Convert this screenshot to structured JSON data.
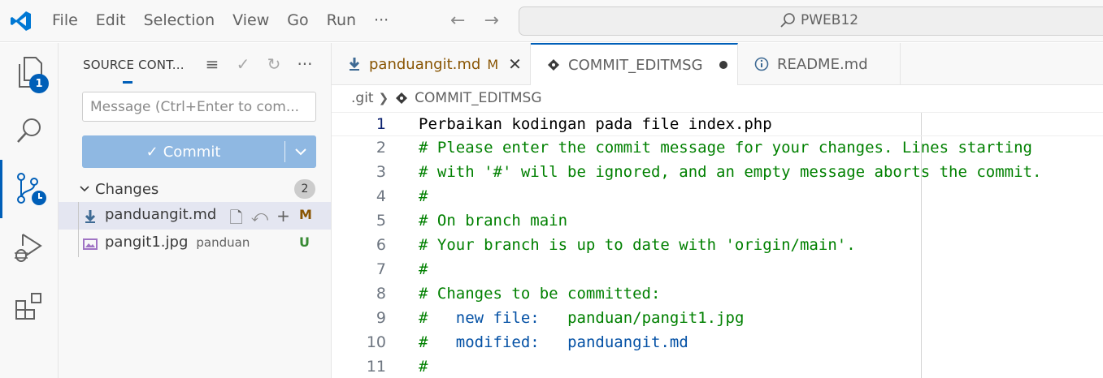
{
  "menu": [
    "File",
    "Edit",
    "Selection",
    "View",
    "Go",
    "Run",
    "···"
  ],
  "search": {
    "label": "PWEB12"
  },
  "activity": {
    "explorer_badge": "1"
  },
  "sidebar": {
    "title": "SOURCE CONT...",
    "message_placeholder": "Message (Ctrl+Enter to com...",
    "commit_label": "Commit",
    "changes_label": "Changes",
    "changes_count": "2",
    "files": [
      {
        "name": "panduangit.md",
        "dir": "",
        "status": "M",
        "status_color": "#895503"
      },
      {
        "name": "pangit1.jpg",
        "dir": "panduan",
        "status": "U",
        "status_color": "#388a34"
      }
    ]
  },
  "tabs": [
    {
      "label": "panduangit.md",
      "modified": "M"
    },
    {
      "label": "COMMIT_EDITMSG"
    },
    {
      "label": "README.md"
    }
  ],
  "breadcrumb": {
    "folder": ".git",
    "file": "COMMIT_EDITMSG"
  },
  "editor": {
    "lines": [
      {
        "n": "1",
        "text": "Perbaikan kodingan pada file index.php"
      },
      {
        "n": "2",
        "text": "# Please enter the commit message for your changes. Lines starting"
      },
      {
        "n": "3",
        "text": "# with '#' will be ignored, and an empty message aborts the commit."
      },
      {
        "n": "4",
        "text": "#"
      },
      {
        "n": "5",
        "text": "# On branch main"
      },
      {
        "n": "6",
        "text": "# Your branch is up to date with 'origin/main'."
      },
      {
        "n": "7",
        "text": "#"
      },
      {
        "n": "8",
        "text": "# Changes to be committed:"
      },
      {
        "n": "9",
        "hash": "#",
        "kw": "new file:",
        "path": "panduan/pangit1.jpg"
      },
      {
        "n": "10",
        "hash": "#",
        "kw": "modified:",
        "path": "panduangit.md"
      },
      {
        "n": "11",
        "text": "#"
      }
    ]
  },
  "colors": {
    "accent": "#005fb8",
    "comment": "#008000",
    "keyword": "#0451a5",
    "commit_button": "#8fb8e2"
  }
}
